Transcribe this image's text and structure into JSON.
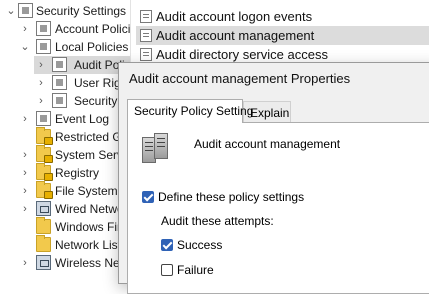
{
  "tree": {
    "items": [
      {
        "label": "Security Settings",
        "chev": "⌄"
      },
      {
        "label": "Account Policies",
        "chev": "›"
      },
      {
        "label": "Local Policies",
        "chev": "⌄"
      },
      {
        "label": "Audit Policy",
        "chev": "›"
      },
      {
        "label": "User Rights Assignment",
        "chev": "›"
      },
      {
        "label": "Security Options",
        "chev": "›"
      },
      {
        "label": "Event Log",
        "chev": "›"
      },
      {
        "label": "Restricted Groups",
        "chev": ""
      },
      {
        "label": "System Services",
        "chev": "›"
      },
      {
        "label": "Registry",
        "chev": "›"
      },
      {
        "label": "File System",
        "chev": "›"
      },
      {
        "label": "Wired Network",
        "chev": "›"
      },
      {
        "label": "Windows Firewall",
        "chev": ""
      },
      {
        "label": "Network List",
        "chev": ""
      },
      {
        "label": "Wireless Network",
        "chev": "›"
      }
    ]
  },
  "list": {
    "items": [
      {
        "label": "Audit account logon events"
      },
      {
        "label": "Audit account management"
      },
      {
        "label": "Audit directory service access"
      }
    ]
  },
  "dialog": {
    "title": "Audit account management Properties",
    "tabs": [
      "Security Policy Setting",
      "Explain"
    ],
    "policy_name": "Audit account management",
    "define_label": "Define these policy settings",
    "define_checked": true,
    "audit_attempts_label": "Audit these attempts:",
    "success_label": "Success",
    "success_checked": true,
    "failure_label": "Failure",
    "failure_checked": false
  },
  "colors": {
    "checkbox_accent": "#2f62b6",
    "selection": "#d9d9d9"
  }
}
